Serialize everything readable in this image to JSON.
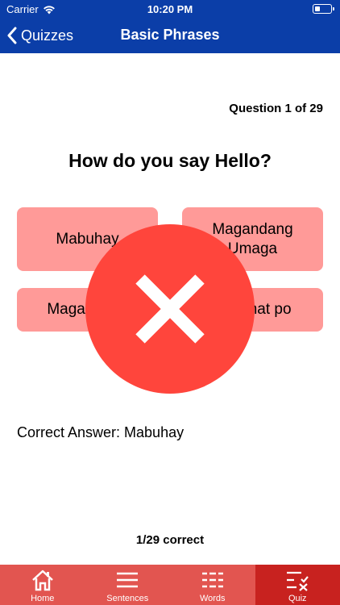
{
  "status": {
    "carrier": "Carrier",
    "time": "10:20 PM",
    "battery_level": 0.35
  },
  "nav": {
    "back_label": "Quizzes",
    "title": "Basic Phrases"
  },
  "quiz": {
    "counter": "Question 1 of 29",
    "question": "How do you say Hello?",
    "answers": [
      "Mabuhay",
      "Magandang Umaga",
      "Magandang",
      "Salamat po"
    ],
    "result": "incorrect",
    "correct_answer_text": "Correct Answer: Mabuhay",
    "score": "1/29 correct"
  },
  "colors": {
    "nav_blue": "#0b3ea8",
    "answer_bg": "#ff9a98",
    "wrong_red": "#ff453c",
    "tab_bg": "#e25550",
    "tab_active": "#c8221f"
  },
  "tabs": [
    {
      "label": "Home",
      "icon": "home-icon"
    },
    {
      "label": "Sentences",
      "icon": "lines-icon"
    },
    {
      "label": "Words",
      "icon": "grid-icon"
    },
    {
      "label": "Quiz",
      "icon": "checklist-icon",
      "active": true
    }
  ]
}
